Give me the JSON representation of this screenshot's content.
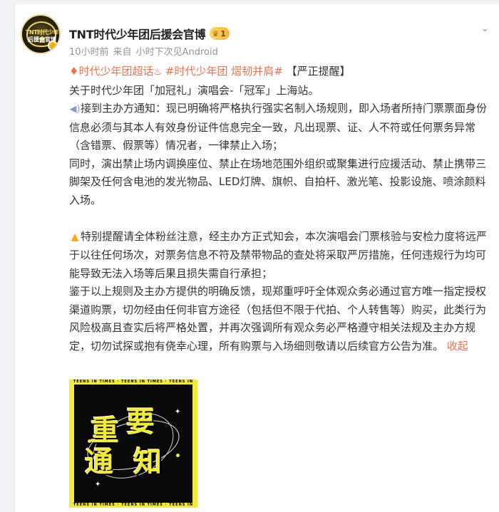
{
  "post": {
    "author": "TNT时代少年团后援会官博",
    "vip_level": "1",
    "time": "10小时前",
    "source_prefix": "来自",
    "source": "小时下次见Android",
    "topic1": "时代少年团超话",
    "topic2": "#时代少年团 熠韧并肩#",
    "tag": "【严正提醒】",
    "line_intro": "关于时代少年团「加冠礼」演唱会-「冠军」上海站。",
    "p1": "接到主办方通知：现已明确将严格执行强实名制入场规则，即入场者所持门票票面身份信息必须与其本人有效身份证件信息完全一致，凡出现票、证、人不符或任何票务异常（含错票、假票等）情况者，一律禁止入场；",
    "p2": "同时，演出禁止场内调换座位、禁止在场地范围外组织或聚集进行应援活动、禁止携带三脚架及任何含电池的发光物品、LED灯牌、旗帜、自拍杆、激光笔、投影设施、喷涂颜料入场。",
    "p3": "特别提醒请全体粉丝注意，经主办方正式知会，本次演唱会门票核验与安检力度将远严于以往任何场次，对票务信息不符及禁带物品的查处将采取严厉措施，任何违规行为均可能导致无法入场等后果且损失需自行承担；",
    "p4": "鉴于以上规则及主办方提供的明确反馈，现郑重呼吁全体观众务必通过官方唯一指定授权渠道购票，切勿经由任何非官方途径（包括但不限于代拍、个人转售等）购买，此类行为风险极高且查实后将严格处置，并再次强调所有观众务必严格遵守相关法规及主办方规定，切勿试探或抱有侥幸心理，所有购票与入场细则敬请以后续官方公告为准。",
    "collapse": "收起"
  },
  "avatar": {
    "line1": "TNT时代少年团",
    "line2": "后援会官博"
  },
  "notice_image": {
    "char1": "重",
    "char2": "要",
    "char3": "通",
    "char4": "知",
    "border_text": "TEENS IN TIMES · TEENS IN TIMES · TEENS IN TIMES"
  },
  "icons": {
    "topic": "diamond-icon",
    "popcorn": "popcorn-icon",
    "speaker": "speaker-icon",
    "warning": "warning-icon",
    "more": "chevron-down-icon",
    "vip": "crown-icon"
  },
  "colors": {
    "accent": "#eb7350",
    "text": "#333333",
    "meta": "#939393",
    "notice_yellow": "#f1ea3a"
  }
}
